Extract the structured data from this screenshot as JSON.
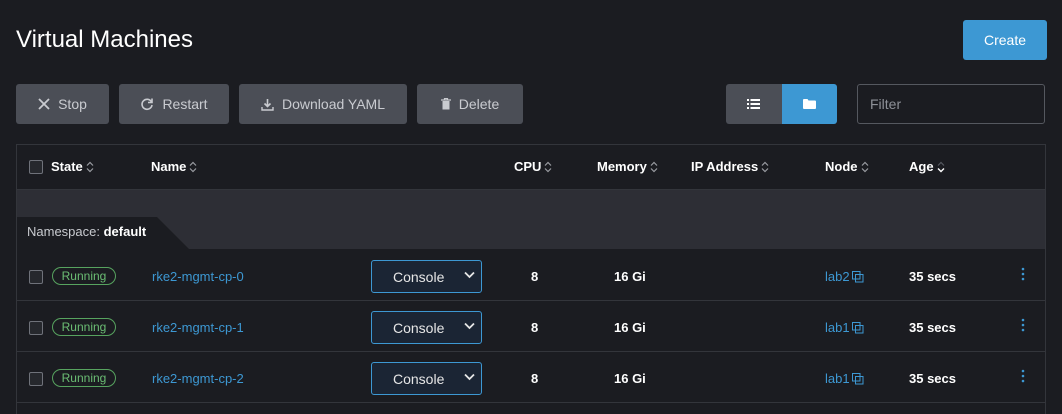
{
  "page": {
    "title": "Virtual Machines",
    "create_label": "Create"
  },
  "toolbar": {
    "stop_label": "Stop",
    "restart_label": "Restart",
    "download_label": "Download YAML",
    "delete_label": "Delete",
    "filter_placeholder": "Filter"
  },
  "table": {
    "headers": {
      "state": "State",
      "name": "Name",
      "cpu": "CPU",
      "memory": "Memory",
      "ip": "IP Address",
      "node": "Node",
      "age": "Age"
    },
    "group": {
      "prefix": "Namespace:",
      "value": "default"
    },
    "rows": [
      {
        "state": "Running",
        "name": "rke2-mgmt-cp-0",
        "action": "Console",
        "cpu": "8",
        "memory": "16 Gi",
        "ip": "",
        "node": "lab2",
        "age": "35 secs"
      },
      {
        "state": "Running",
        "name": "rke2-mgmt-cp-1",
        "action": "Console",
        "cpu": "8",
        "memory": "16 Gi",
        "ip": "",
        "node": "lab1",
        "age": "35 secs"
      },
      {
        "state": "Running",
        "name": "rke2-mgmt-cp-2",
        "action": "Console",
        "cpu": "8",
        "memory": "16 Gi",
        "ip": "",
        "node": "lab1",
        "age": "35 secs"
      }
    ]
  },
  "colors": {
    "accent": "#3d98d3",
    "running": "#6bbd73",
    "background": "#1b1c21"
  },
  "icons": [
    "close-icon",
    "restart-icon",
    "download-icon",
    "trash-icon",
    "list-icon",
    "folder-icon",
    "sort-icon",
    "chevron-down-icon",
    "copy-icon",
    "kebab-icon"
  ]
}
